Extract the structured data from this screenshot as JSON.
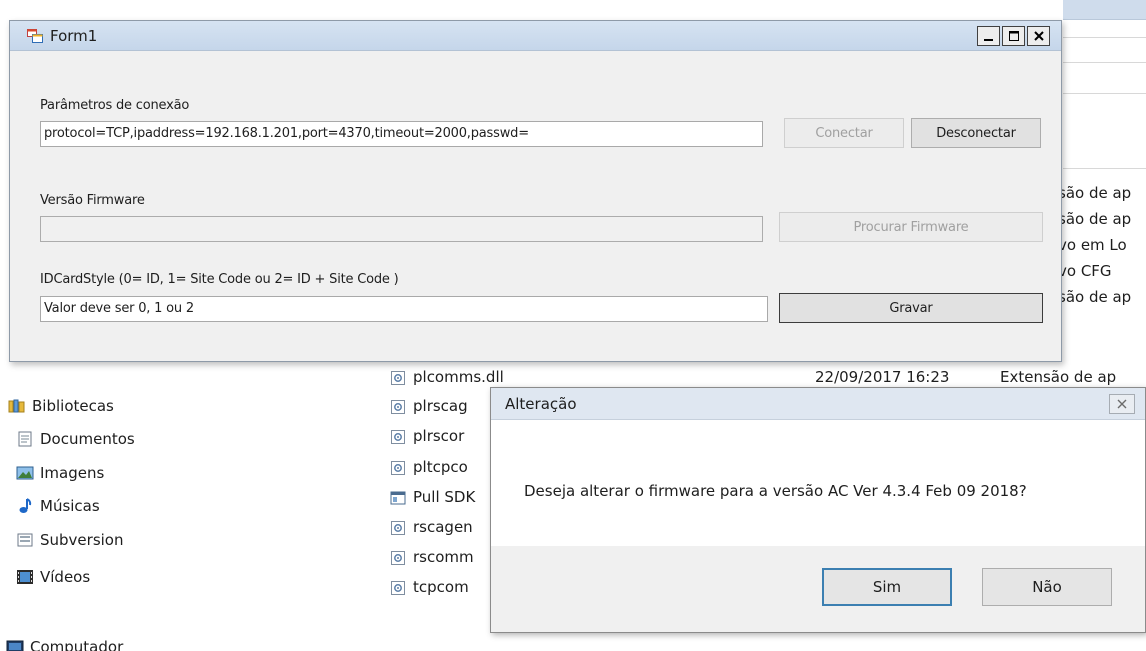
{
  "explorer": {
    "nav": [
      {
        "label": "Bibliotecas",
        "icon": "library-icon"
      },
      {
        "label": "Documentos",
        "icon": "documents-icon"
      },
      {
        "label": "Imagens",
        "icon": "pictures-icon"
      },
      {
        "label": "Músicas",
        "icon": "music-icon"
      },
      {
        "label": "Subversion",
        "icon": "subversion-icon"
      },
      {
        "label": "Vídeos",
        "icon": "videos-icon"
      },
      {
        "label": "Computador",
        "icon": "computer-icon"
      }
    ],
    "type_tails": [
      "são de ap",
      "são de ap",
      "vo em Lo",
      "vo CFG",
      "são de ap"
    ],
    "files": [
      {
        "name": "plcomms.dll",
        "date": "22/09/2017 16:23",
        "type": "Extensão de ap",
        "icon": "dll-file-icon"
      },
      {
        "name": "plrscag",
        "date": "",
        "type": "",
        "icon": "dll-file-icon"
      },
      {
        "name": "plrscor",
        "date": "",
        "type": "",
        "icon": "dll-file-icon"
      },
      {
        "name": "pltcpco",
        "date": "",
        "type": "",
        "icon": "dll-file-icon"
      },
      {
        "name": "Pull SDK",
        "date": "",
        "type": "",
        "icon": "application-icon"
      },
      {
        "name": "rscagen",
        "date": "",
        "type": "",
        "icon": "dll-file-icon"
      },
      {
        "name": "rscomm",
        "date": "",
        "type": "",
        "icon": "dll-file-icon"
      },
      {
        "name": "tcpcom",
        "date": "",
        "type": "",
        "icon": "dll-file-icon"
      }
    ]
  },
  "form1": {
    "title": "Form1",
    "conn_label": "Parâmetros de conexão",
    "conn_value": "protocol=TCP,ipaddress=192.168.1.201,port=4370,timeout=2000,passwd=",
    "connect_label": "Conectar",
    "disconnect_label": "Desconectar",
    "firmware_label": "Versão Firmware",
    "firmware_value": "",
    "search_firmware_label": "Procurar Firmware",
    "idcard_label": "IDCardStyle (0= ID, 1= Site Code ou 2= ID + Site Code )",
    "idcard_value": "Valor deve ser 0, 1 ou 2",
    "save_label": "Gravar"
  },
  "dialog": {
    "title": "Alteração",
    "message": "Deseja alterar o firmware para a versão AC Ver 4.3.4 Feb 09 2018?",
    "yes_label": "Sim",
    "no_label": "Não"
  }
}
